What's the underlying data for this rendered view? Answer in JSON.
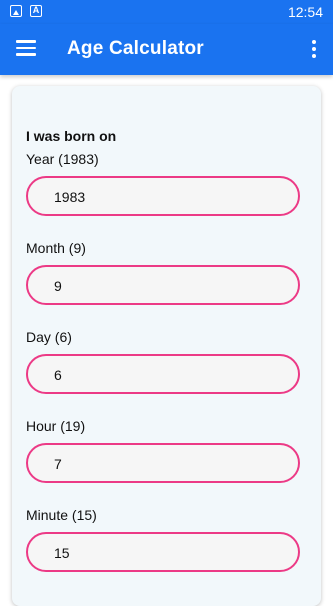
{
  "status_bar": {
    "time": "12:54",
    "icons": [
      "image-icon",
      "a-icon"
    ]
  },
  "app_bar": {
    "title": "Age Calculator",
    "icons": [
      "menu-icon",
      "more-vert-icon"
    ]
  },
  "form": {
    "heading": "I was born on",
    "fields": [
      {
        "label": "Year (1983)",
        "value": "1983"
      },
      {
        "label": "Month (9)",
        "value": "9"
      },
      {
        "label": "Day (6)",
        "value": "6"
      },
      {
        "label": "Hour (19)",
        "value": "7"
      },
      {
        "label": "Minute (15)",
        "value": "15"
      }
    ]
  },
  "colors": {
    "primary": "#1a73f0",
    "accent": "#ec3a86",
    "card_bg": "#f2f8fb"
  }
}
